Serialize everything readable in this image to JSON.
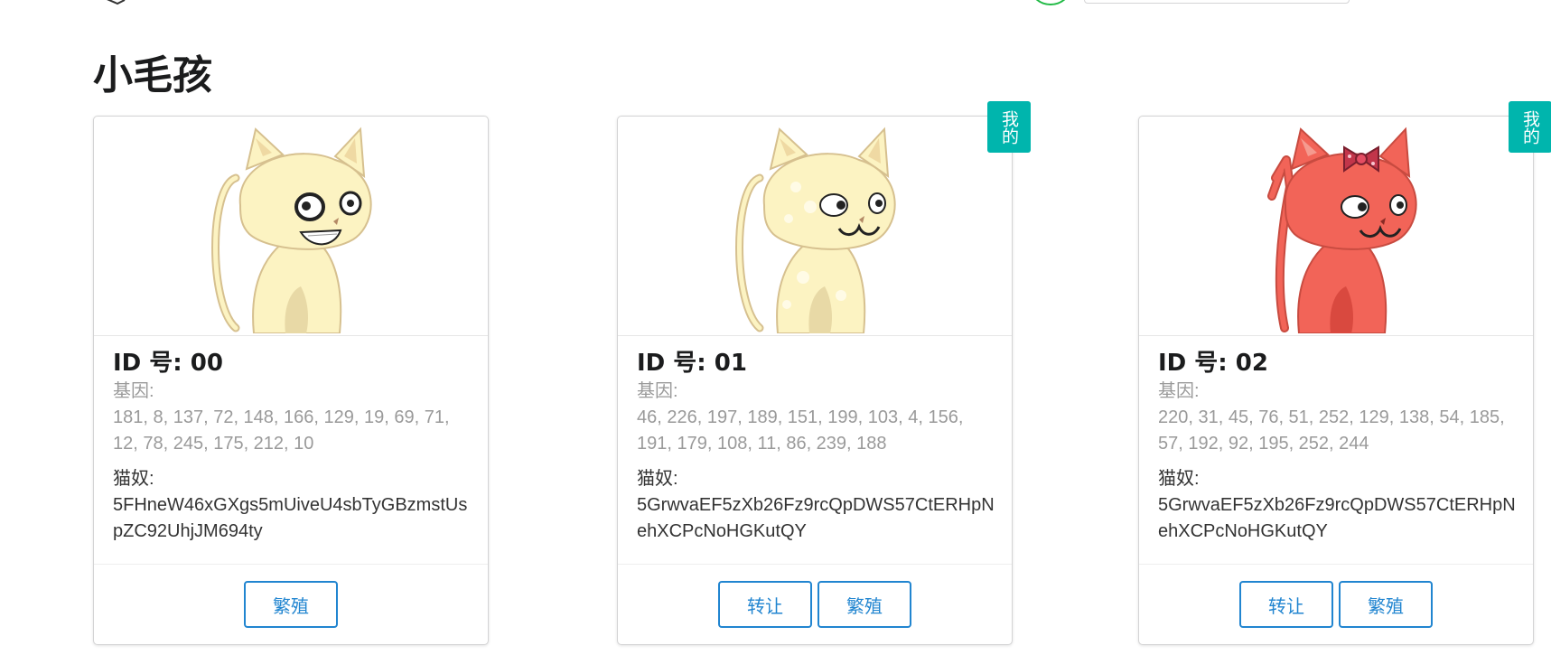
{
  "page": {
    "title": "小毛孩"
  },
  "labels": {
    "gene": "基因:",
    "owner": "猫奴:",
    "mine": "我的"
  },
  "colors": {
    "primary": "#2185d0",
    "ribbon": "#00b5ad",
    "cat_cream": "#fcf3c2",
    "cat_red": "#f26458"
  },
  "cards": [
    {
      "id": "ID 号: 00",
      "genes": "181, 8, 137, 72, 148, 166, 129, 19, 69, 71, 12, 78, 245, 175, 212, 10",
      "owner": "5FHneW46xGXgs5mUiveU4sbTyGBzmstUspZC92UhjJM694ty",
      "mine": false,
      "buttons": [
        "繁殖"
      ],
      "cat": "cream-grinning-cat-icon"
    },
    {
      "id": "ID 号: 01",
      "genes": "46, 226, 197, 189, 151, 199, 103, 4, 156, 191, 179, 108, 11, 86, 239, 188",
      "owner": "5GrwvaEF5zXb26Fz9rcQpDWS57CtERHpNehXCPcNoHGKutQY",
      "mine": true,
      "buttons": [
        "转让",
        "繁殖"
      ],
      "cat": "cream-spotted-cat-icon"
    },
    {
      "id": "ID 号: 02",
      "genes": "220, 31, 45, 76, 51, 252, 129, 138, 54, 185, 57, 192, 92, 195, 252, 244",
      "owner": "5GrwvaEF5zXb26Fz9rcQpDWS57CtERHpNehXCPcNoHGKutQY",
      "mine": true,
      "buttons": [
        "转让",
        "繁殖"
      ],
      "cat": "red-bow-cat-icon"
    }
  ]
}
